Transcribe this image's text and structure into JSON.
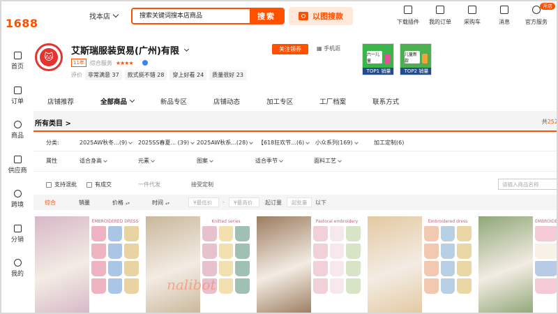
{
  "topbar": {
    "logo": "1688",
    "find_store_label": "找本店",
    "search_placeholder": "搜索关键词搜本店商品",
    "search_button": "搜索",
    "image_search": "以图搜款",
    "icons": [
      {
        "name": "plugin-icon",
        "label": "下载插件"
      },
      {
        "name": "order-icon",
        "label": "我的订单"
      },
      {
        "name": "cart-icon",
        "label": "采购车"
      },
      {
        "name": "message-icon",
        "label": "消息"
      },
      {
        "name": "service-icon",
        "label": "官方服务",
        "badge": "开店"
      }
    ]
  },
  "sidebar": {
    "items": [
      {
        "icon": "home-icon",
        "label": "首页"
      },
      {
        "icon": "order-icon",
        "label": "订单"
      },
      {
        "icon": "product-icon",
        "label": "商品"
      },
      {
        "icon": "supplier-icon",
        "label": "供应商"
      },
      {
        "icon": "cross-border-icon",
        "label": "跨境"
      },
      {
        "icon": "distribution-icon",
        "label": "分销"
      },
      {
        "icon": "mine-icon",
        "label": "我的"
      }
    ]
  },
  "shop": {
    "name": "艾斯瑞服装贸易(广州)有限",
    "years": "11年",
    "service_label": "综合服务",
    "stars": "★★★★",
    "rating_label": "评价",
    "ratings": [
      {
        "label": "非常满意",
        "count": "37"
      },
      {
        "label": "款式挺不错",
        "count": "28"
      },
      {
        "label": "穿上好看",
        "count": "24"
      },
      {
        "label": "质量很好",
        "count": "23"
      }
    ],
    "follow_button": "关注领券",
    "mobile_label": "手机逛",
    "promos": [
      {
        "badge": "TOP1 销量",
        "text": "六一儿童"
      },
      {
        "badge": "TOP2 销量",
        "text": "儿童新款"
      }
    ]
  },
  "tabs": [
    {
      "label": "店铺推荐"
    },
    {
      "label": "全部商品",
      "active": true
    },
    {
      "label": "新品专区"
    },
    {
      "label": "店铺动态"
    },
    {
      "label": "加工专区"
    },
    {
      "label": "工厂档案"
    },
    {
      "label": "联系方式"
    }
  ],
  "category_bar": {
    "title": "所有类目 >",
    "total_prefix": "共",
    "total": "252"
  },
  "filters": {
    "category_label": "分类:",
    "categories": [
      "2025AW秋冬...(9)",
      "2025SS春夏... (39)",
      "2025AW秋系...(28)",
      "【618狂欢节...(6)",
      "小众系列(169)",
      "加工定制(6)"
    ],
    "attr_label": "属性",
    "attributes": [
      "适合身高",
      "元素",
      "图案",
      "适合季节",
      "面料工艺"
    ]
  },
  "checks": {
    "mixed": "支持混批",
    "deal": "有成交",
    "dropship": "一件代发",
    "custom": "接受定制",
    "search_placeholder": "请输入商品名称"
  },
  "sort": {
    "comprehensive": "综合",
    "sales": "销量",
    "price": "价格",
    "time": "时间",
    "min_price": "¥最低价",
    "max_price": "¥最高价",
    "moq_label": "起订量",
    "moq_input": "起批量",
    "below": "以下"
  },
  "products": [
    {
      "caption": "EMBROIDERED DRESS",
      "watermark": "",
      "colors": {
        "photo": "#d7b8c7",
        "a": "#f0b3c2",
        "b": "#a9c6e6",
        "c": "#e9d3a3"
      }
    },
    {
      "caption": "Knitted series",
      "watermark": "nalibot",
      "colors": {
        "photo": "#c9b79a",
        "a": "#e7c2cc",
        "b": "#f3e0b0",
        "c": "#9fc1b3"
      }
    },
    {
      "caption": "Pastoral embroidery",
      "watermark": "",
      "colors": {
        "photo": "#9c7c5f",
        "a": "#f2d0d7",
        "b": "#f7e8ee",
        "c": "#d8e4c6"
      }
    },
    {
      "caption": "Embroidered dress",
      "watermark": "",
      "colors": {
        "photo": "#e3c9a1",
        "a": "#f1c9b1",
        "b": "#b8cfe4",
        "c": "#ead7a4"
      }
    },
    {
      "caption": "EMBROIDERED",
      "watermark": "",
      "colors": {
        "photo": "#8fa777",
        "a": "#f5c9d6",
        "b": "#f7f1e6",
        "c": "#b8cbe6"
      }
    }
  ]
}
